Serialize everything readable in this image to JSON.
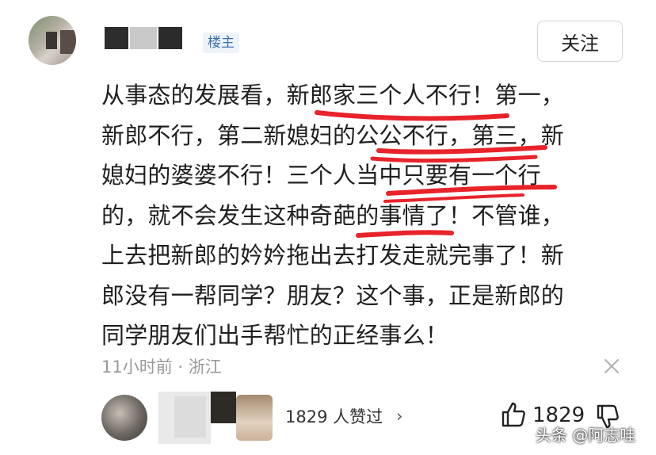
{
  "comment": {
    "author_badge": "楼主",
    "follow_label": "关注",
    "text": "从事态的发展看，新郎家三个人不行！第一，\n新郎不行，第二新媳妇的公公不行，第三，新\n媳妇的婆婆不行！三个人当中只要有一个行\n的，就不会发生这种奇葩的事情了！不管谁，\n上去把新郎的妗妗拖出去打发走就完事了！新\n郎没有一帮同学？朋友？这个事，正是新郎的\n同学朋友们出手帮忙的正经事么！",
    "time": "11小时前",
    "separator": "·",
    "location": "浙江"
  },
  "likes": {
    "liked_by_text": "1829 人赞过",
    "chevron": "›",
    "count": "1829"
  },
  "watermark": "头条 @阿志哇",
  "colors": {
    "underline_red": "#e8232a",
    "badge_blue": "#3d6fb3",
    "meta_gray": "#9a9a9a"
  }
}
